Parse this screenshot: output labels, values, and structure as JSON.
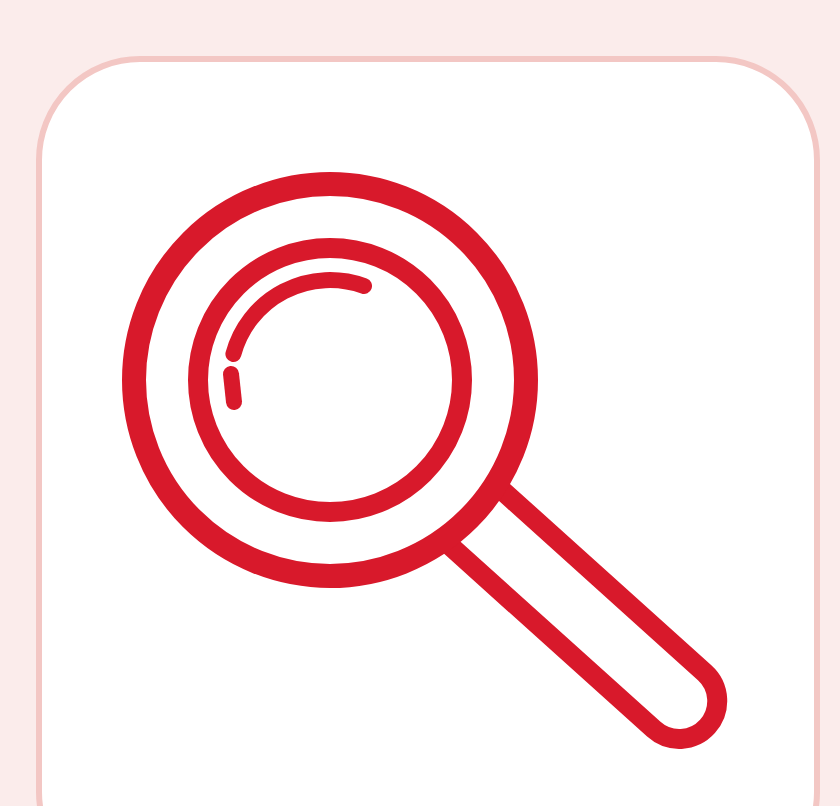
{
  "tile": {
    "kind": "search"
  }
}
